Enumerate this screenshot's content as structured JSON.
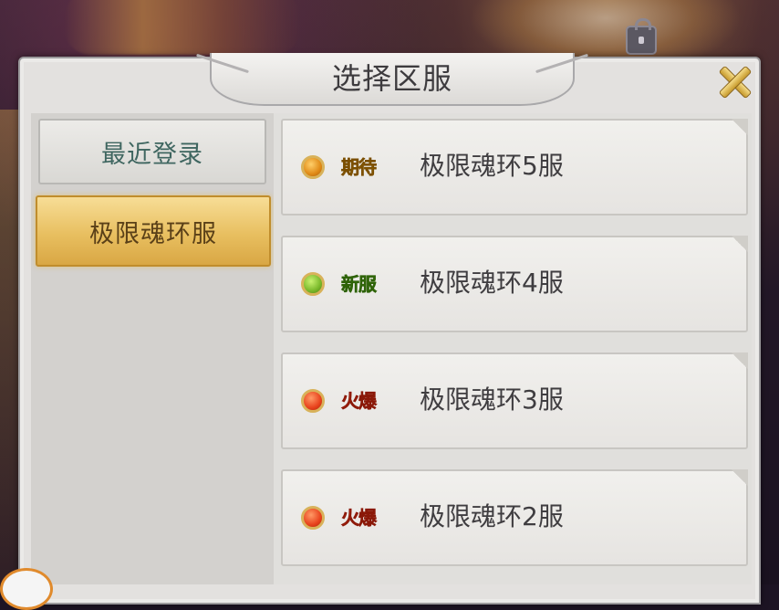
{
  "dialog": {
    "title": "选择区服",
    "close_icon": "close-x-icon"
  },
  "categories": [
    {
      "label": "最近登录",
      "selected": false
    },
    {
      "label": "极限魂环服",
      "selected": true
    }
  ],
  "servers": [
    {
      "status": "期待",
      "status_color": "#e08a16",
      "name": "极限魂环5服"
    },
    {
      "status": "新服",
      "status_color": "#79b82a",
      "name": "极限魂环4服"
    },
    {
      "status": "火爆",
      "status_color": "#e8421c",
      "name": "极限魂环3服"
    },
    {
      "status": "火爆",
      "status_color": "#e8421c",
      "name": "极限魂环2服"
    }
  ]
}
